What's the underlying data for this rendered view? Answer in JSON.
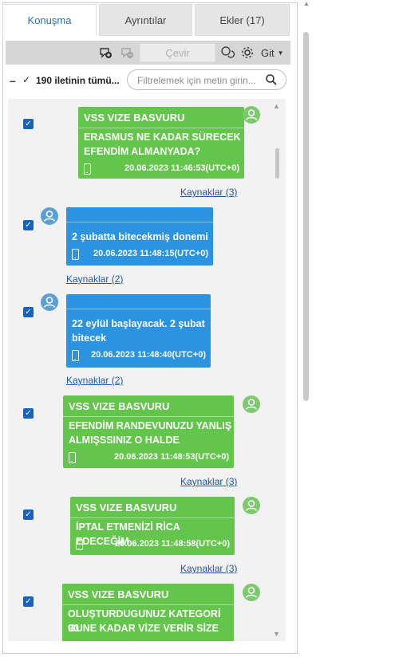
{
  "tabs": [
    {
      "label": "Konuşma",
      "active": true
    },
    {
      "label": "Ayrıntılar",
      "active": false
    },
    {
      "label": "Ekler (17)",
      "active": false
    }
  ],
  "toolbar": {
    "translate_label": "Çevir",
    "go_label": "Git",
    "icons": [
      "add-contact-icon",
      "remove-contact-icon",
      "chat-bubbles-icon",
      "gear-icon",
      "chevron-down-icon"
    ]
  },
  "filter": {
    "collapse_symbol": "–",
    "check_symbol": "✓",
    "count_label": "190 iletinin tümü...",
    "placeholder": "Filtrelemek için metin girin..."
  },
  "messages": [
    {
      "direction": "outgoing",
      "color": "#63c54b",
      "sender": "VSS VIZE BASVURU",
      "text_lines": [
        "ERASMUS NE KADAR SÜRECEK",
        "EFENDİM ALMANYADA?"
      ],
      "timestamp": "20.06.2023 11:46:53(UTC+0)",
      "sources": "Kaynaklar (3)",
      "checked": true
    },
    {
      "direction": "incoming",
      "color": "#2b93e0",
      "sender": "",
      "text_lines": [
        "2 şubatta bitecekmiş donemi"
      ],
      "timestamp": "20.06.2023 11:48:15(UTC+0)",
      "sources": "Kaynaklar (2)",
      "checked": true
    },
    {
      "direction": "incoming",
      "color": "#2b93e0",
      "sender": "",
      "text_lines": [
        "22 eylül başlayacak.  2 şubat",
        "bitecek"
      ],
      "timestamp": "20.06.2023 11:48:40(UTC+0)",
      "sources": "Kaynaklar (2)",
      "checked": true
    },
    {
      "direction": "outgoing",
      "color": "#63c54b",
      "sender": "VSS VIZE BASVURU",
      "text_lines": [
        "EFENDİM RANDEVUNUZU YANLIŞ",
        "ALMIŞSSINIZ O HALDE"
      ],
      "timestamp": "20.06.2023 11:48:53(UTC+0)",
      "sources": "Kaynaklar (3)",
      "checked": true
    },
    {
      "direction": "outgoing",
      "color": "#63c54b",
      "sender": "VSS VIZE BASVURU",
      "text_lines": [
        "İPTAL ETMENİZİ RİCA EDECEĞİM"
      ],
      "timestamp": "20.06.2023 11:48:58(UTC+0)",
      "sources": "Kaynaklar (3)",
      "checked": true
    },
    {
      "direction": "outgoing",
      "color": "#63c54b",
      "sender": "VSS VIZE BASVURU",
      "text_lines": [
        "OLUŞTURDUGUNUZ KATEGORİ 90",
        "GUNE KADAR VİZE VERİR SİZE"
      ],
      "timestamp": "",
      "sources": "",
      "checked": true
    }
  ]
}
